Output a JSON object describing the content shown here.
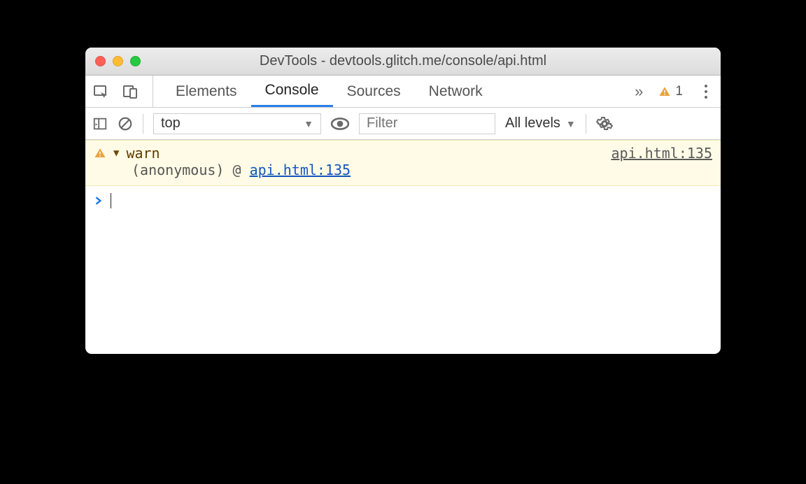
{
  "window": {
    "title": "DevTools - devtools.glitch.me/console/api.html"
  },
  "tabs": {
    "items": [
      {
        "label": "Elements"
      },
      {
        "label": "Console"
      },
      {
        "label": "Sources"
      },
      {
        "label": "Network"
      }
    ],
    "active_index": 1,
    "overflow_glyph": "»",
    "warning_count": "1"
  },
  "toolbar": {
    "context": "top",
    "filter_placeholder": "Filter",
    "levels_label": "All levels"
  },
  "console": {
    "warn": {
      "label": "warn",
      "source": "api.html:135",
      "anon": "(anonymous)",
      "at": "@",
      "link": "api.html:135"
    }
  }
}
